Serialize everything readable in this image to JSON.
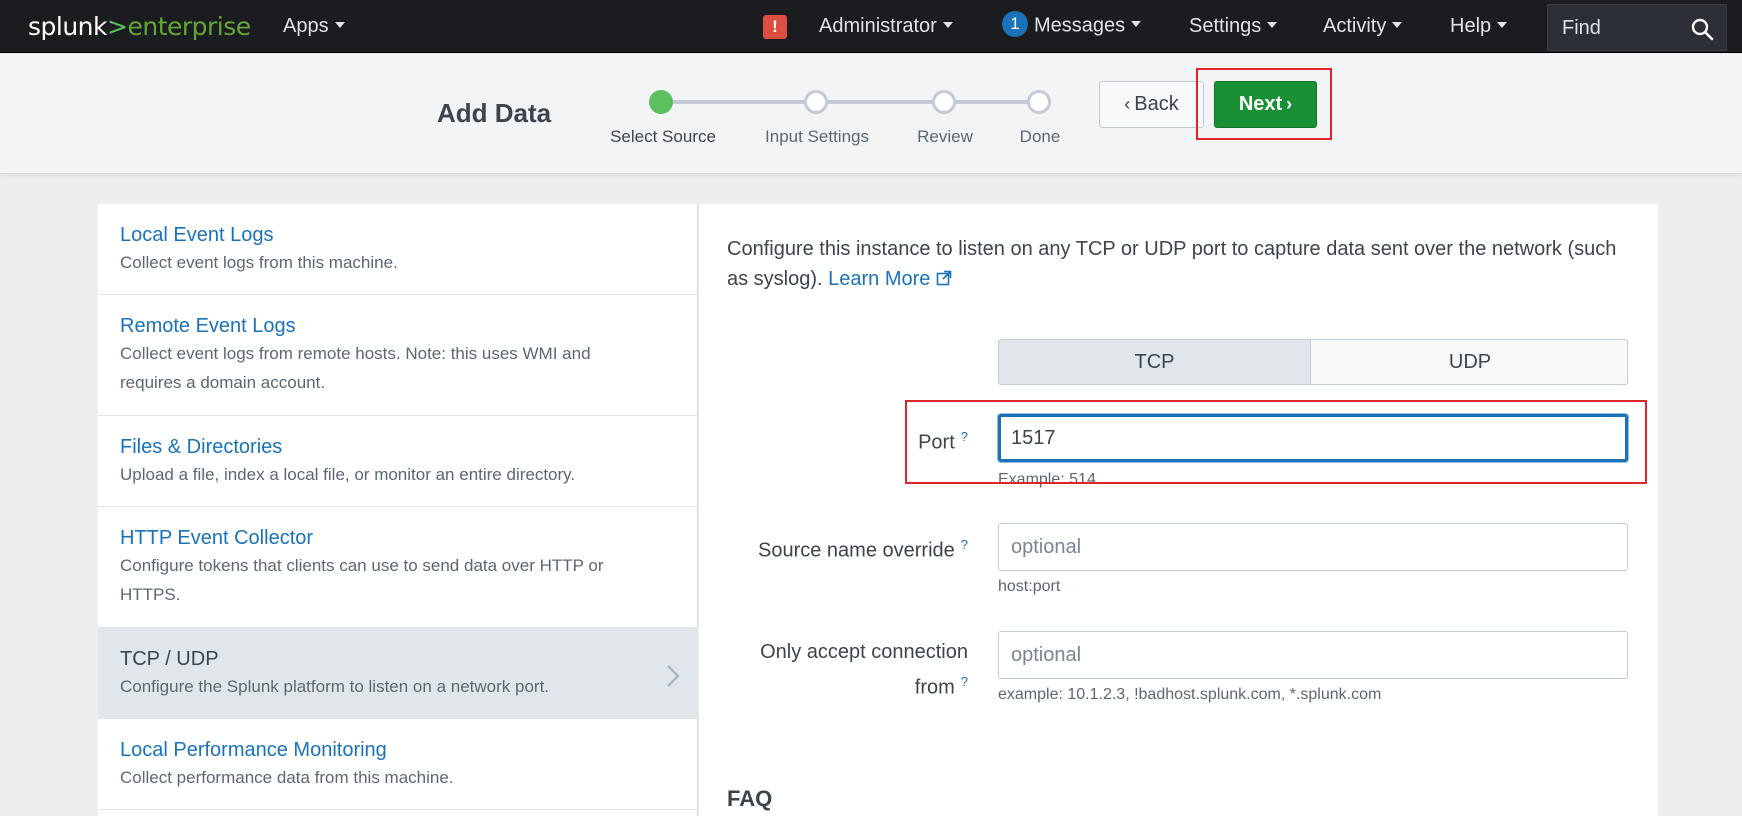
{
  "topbar": {
    "logo_main": "splunk",
    "logo_gt": ">",
    "logo_suffix": "enterprise",
    "apps": "Apps",
    "alert_glyph": "!",
    "user": "Administrator",
    "messages_count": "1",
    "messages": "Messages",
    "settings": "Settings",
    "activity": "Activity",
    "help": "Help",
    "find_placeholder": "Find"
  },
  "header": {
    "title": "Add Data",
    "steps": [
      {
        "label": "Select Source",
        "state": "active"
      },
      {
        "label": "Input Settings",
        "state": "pending"
      },
      {
        "label": "Review",
        "state": "pending"
      },
      {
        "label": "Done",
        "state": "pending"
      }
    ],
    "back_label": "Back",
    "next_label": "Next"
  },
  "sources": [
    {
      "title": "Local Event Logs",
      "desc": "Collect event logs from this machine."
    },
    {
      "title": "Remote Event Logs",
      "desc": "Collect event logs from remote hosts. Note: this uses WMI and requires a domain account."
    },
    {
      "title": "Files & Directories",
      "desc": "Upload a file, index a local file, or monitor an entire directory."
    },
    {
      "title": "HTTP Event Collector",
      "desc": "Configure tokens that clients can use to send data over HTTP or HTTPS."
    },
    {
      "title": "TCP / UDP",
      "desc": "Configure the Splunk platform to listen on a network port."
    },
    {
      "title": "Local Performance Monitoring",
      "desc": "Collect performance data from this machine."
    }
  ],
  "form": {
    "intro": "Configure this instance to listen on any TCP or UDP port to capture data sent over the network (such as syslog).",
    "learn_more": "Learn More",
    "protocol_options": [
      "TCP",
      "UDP"
    ],
    "selected_protocol": "TCP",
    "port_label": "Port",
    "port_value": "1517",
    "port_help": "Example: 514",
    "source_label": "Source name override",
    "source_placeholder": "optional",
    "source_help": "host:port",
    "accept_label_1": "Only accept connection",
    "accept_label_2": "from",
    "accept_placeholder": "optional",
    "accept_help": "example: 10.1.2.3, !badhost.splunk.com, *.splunk.com",
    "help_mark": "?",
    "faq": "FAQ"
  },
  "colors": {
    "accent": "#1a73b8",
    "next_green": "#1a9035",
    "step_active": "#5cc05c",
    "highlight_red": "#e0242b"
  }
}
